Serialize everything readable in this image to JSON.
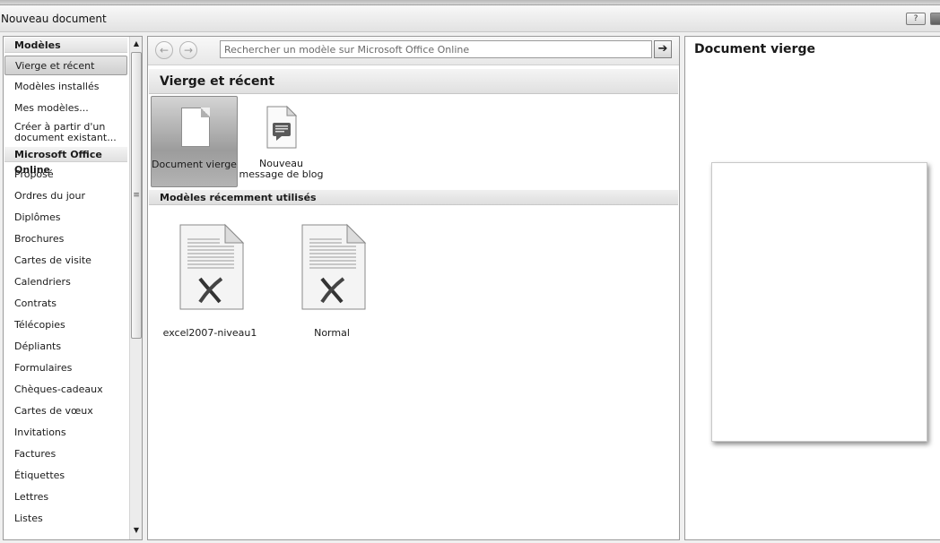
{
  "window": {
    "title": "Nouveau document",
    "help_label": "?"
  },
  "sidebar": {
    "header_templates": "Modèles",
    "items_local": [
      "Vierge et récent",
      "Modèles installés",
      "Mes modèles...",
      "Créer à partir d'un document existant..."
    ],
    "header_online": "Microsoft Office Online",
    "items_online": [
      "Proposé",
      "Ordres du jour",
      "Diplômes",
      "Brochures",
      "Cartes de visite",
      "Calendriers",
      "Contrats",
      "Télécopies",
      "Dépliants",
      "Formulaires",
      "Chèques-cadeaux",
      "Cartes de vœux",
      "Invitations",
      "Factures",
      "Étiquettes",
      "Lettres",
      "Listes"
    ],
    "selected": "Vierge et récent"
  },
  "toolbar": {
    "search_placeholder": "Rechercher un modèle sur Microsoft Office Online"
  },
  "main": {
    "section_title": "Vierge et récent",
    "tiles": [
      {
        "label": "Document vierge",
        "icon": "blank-page-icon",
        "selected": true
      },
      {
        "label": "Nouveau message de blog",
        "icon": "blog-post-icon",
        "selected": false
      }
    ],
    "recent_header": "Modèles récemment utilisés",
    "recent": [
      {
        "label": "excel2007-niveau1",
        "icon": "excel-template-icon"
      },
      {
        "label": "Normal",
        "icon": "excel-template-icon"
      }
    ]
  },
  "preview": {
    "title": "Document vierge"
  }
}
